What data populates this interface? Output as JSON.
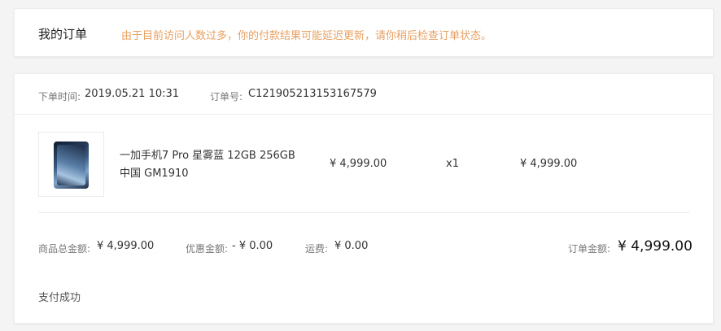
{
  "header": {
    "title": "我的订单",
    "notice": "由于目前访问人数过多，你的付款结果可能延迟更新，请你稍后检查订单状态。"
  },
  "order": {
    "time_label": "下单时间:",
    "time_value": "2019.05.21 10:31",
    "number_label": "订单号:",
    "number_value": "C121905213153167579",
    "product": {
      "name_line1": "一加手机7 Pro 星雾蓝 12GB 256GB",
      "name_line2": "中国 GM1910",
      "image_icon": "phone-product-image",
      "unit_price": "¥  4,999.00",
      "quantity": "x1",
      "subtotal": "¥  4,999.00"
    },
    "summary": {
      "goods_total_label": "商品总金额:",
      "goods_total_value": "¥  4,999.00",
      "discount_label": "优惠金额:",
      "discount_value": "- ¥  0.00",
      "shipping_label": "运费:",
      "shipping_value": "¥  0.00",
      "order_total_label": "订单金额:",
      "order_total_value": "¥  4,999.00"
    },
    "status": "支付成功"
  },
  "colors": {
    "notice": "#e8a062",
    "background": "#f4f4f4"
  }
}
